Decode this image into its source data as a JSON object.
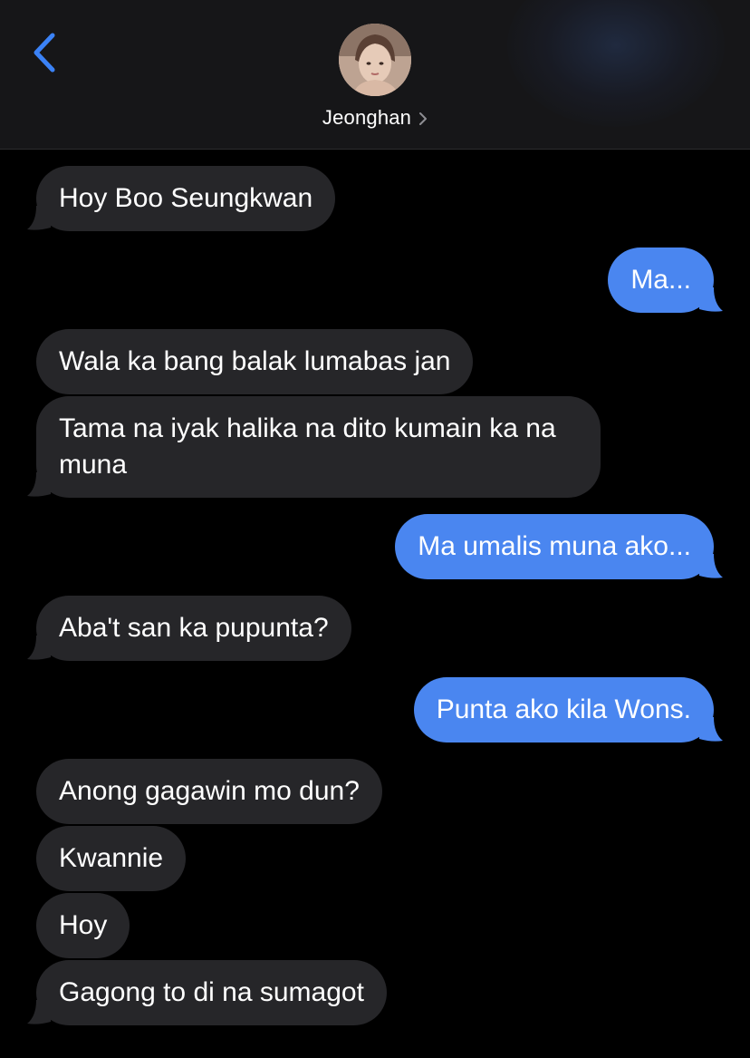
{
  "header": {
    "contact_name": "Jeonghan",
    "back_icon": "chevron-left-icon",
    "detail_icon": "chevron-right-icon"
  },
  "colors": {
    "background": "#000000",
    "header": "#161618",
    "incoming_bubble": "#262629",
    "outgoing_bubble": "#4a86f0",
    "accent": "#3b82f6"
  },
  "messages": [
    {
      "direction": "incoming",
      "text": "Hoy Boo Seungkwan"
    },
    {
      "direction": "outgoing",
      "text": "Ma..."
    },
    {
      "direction": "incoming",
      "text": "Wala ka bang balak lumabas jan"
    },
    {
      "direction": "incoming",
      "text": "Tama na iyak halika na dito kumain ka na muna"
    },
    {
      "direction": "outgoing",
      "text": "Ma umalis muna ako..."
    },
    {
      "direction": "incoming",
      "text": "Aba't san ka pupunta?"
    },
    {
      "direction": "outgoing",
      "text": "Punta ako kila Wons."
    },
    {
      "direction": "incoming",
      "text": "Anong gagawin mo dun?"
    },
    {
      "direction": "incoming",
      "text": "Kwannie"
    },
    {
      "direction": "incoming",
      "text": "Hoy"
    },
    {
      "direction": "incoming",
      "text": "Gagong to di na sumagot"
    }
  ]
}
